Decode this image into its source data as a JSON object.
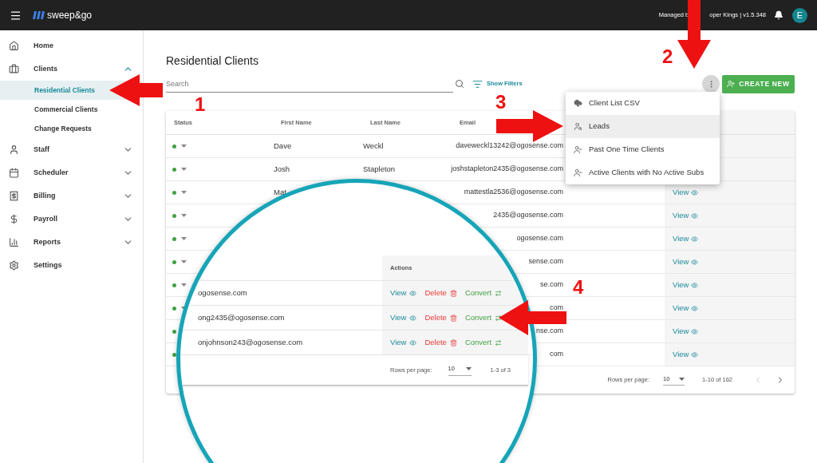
{
  "topbar": {
    "logo": "sweep&go",
    "managed_by_parts": [
      "Managed b",
      "oper Kings | v1.5.348"
    ],
    "avatar": "E"
  },
  "sidebar": {
    "items": [
      {
        "label": "Home"
      },
      {
        "label": "Clients",
        "expanded": true,
        "children": [
          {
            "label": "Residential Clients",
            "selected": true
          },
          {
            "label": "Commercial Clients",
            "selected": false
          },
          {
            "label": "Change Requests",
            "selected": false
          }
        ]
      },
      {
        "label": "Staff",
        "expanded": false
      },
      {
        "label": "Scheduler",
        "expanded": false
      },
      {
        "label": "Billing",
        "expanded": false
      },
      {
        "label": "Payroll",
        "expanded": false
      },
      {
        "label": "Reports",
        "expanded": false
      },
      {
        "label": "Settings"
      }
    ]
  },
  "page": {
    "title": "Residential Clients",
    "search": {
      "placeholder": "Search"
    },
    "filters_button": "Show Filters",
    "create_button": "CREATE NEW"
  },
  "menu": {
    "items": [
      {
        "label": "Client List CSV",
        "selected": false
      },
      {
        "label": "Leads",
        "selected": true
      },
      {
        "label": "Past One Time Clients",
        "selected": false
      },
      {
        "label": "Active Clients with No Active Subs",
        "selected": false
      }
    ]
  },
  "table": {
    "columns": [
      "Status",
      "First Name",
      "Last Name",
      "Email"
    ],
    "rows": [
      {
        "active": true,
        "first_name": "Dave",
        "last_name": "Weckl",
        "email": "daveweckl13242@ogosense.com"
      },
      {
        "active": true,
        "first_name": "Josh",
        "last_name": "Stapleton",
        "email": "joshstapleton2435@ogosense.com"
      },
      {
        "active": true,
        "first_name": "Mat",
        "email": "mattestla2536@ogosense.com",
        "action": "View"
      },
      {
        "active": true,
        "email": "2435@ogosense.com",
        "action": "View"
      },
      {
        "active": true,
        "email": "ogosense.com",
        "action": "View"
      },
      {
        "active": true,
        "email": "sense.com",
        "action": "View"
      },
      {
        "active": true,
        "email": "se.com",
        "action": "View"
      },
      {
        "active": true,
        "email": "com",
        "action": "View"
      },
      {
        "active": true,
        "email": "nse.com",
        "action": "View"
      },
      {
        "active": true,
        "email": "com",
        "action": "View"
      }
    ],
    "footer": {
      "rows_per_page_label": "Rows per page:",
      "rows_per_page": "10",
      "range": "1-10 of 162",
      "prev_disabled": true
    }
  },
  "zoom_view": {
    "columns": [
      "Actions"
    ],
    "rows": [
      {
        "email": "ogosense.com",
        "actions": [
          {
            "kind": "view",
            "label": "View"
          },
          {
            "kind": "delete",
            "label": "Delete"
          },
          {
            "kind": "convert",
            "label": "Convert"
          }
        ]
      },
      {
        "email": "ong2435@ogosense.com",
        "actions": [
          {
            "kind": "view",
            "label": "View"
          },
          {
            "kind": "delete",
            "label": "Delete"
          },
          {
            "kind": "convert",
            "label": "Convert"
          }
        ]
      },
      {
        "email": "onjohnson243@ogosense.com",
        "actions": [
          {
            "kind": "view",
            "label": "View"
          },
          {
            "kind": "delete",
            "label": "Delete"
          },
          {
            "kind": "convert",
            "label": "Convert"
          }
        ]
      }
    ],
    "footer": {
      "rows_per_page_label": "Rows per page:",
      "rows_per_page": "10",
      "range": "1-3 of 3"
    }
  },
  "annotations": [
    {
      "number": "1"
    },
    {
      "number": "2"
    },
    {
      "number": "3"
    },
    {
      "number": "4"
    }
  ]
}
